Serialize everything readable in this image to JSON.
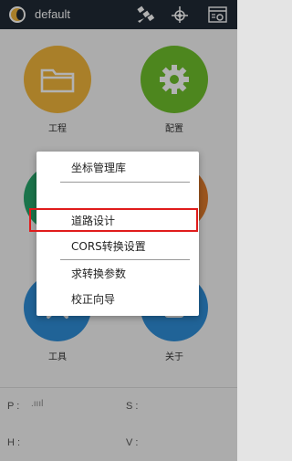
{
  "app": {
    "title": "default"
  },
  "toolbar": {
    "icons": [
      "satellite-icon",
      "crosshair-icon",
      "settings-panel-icon"
    ]
  },
  "grid": [
    {
      "label": "工程",
      "icon": "folder-icon",
      "color": "#f3b73b"
    },
    {
      "label": "配置",
      "icon": "gear-icon",
      "color": "#6fc12b"
    },
    {
      "label": "",
      "icon": "",
      "color": "#28a66c"
    },
    {
      "label": "",
      "icon": "",
      "color": "#e07a2c"
    },
    {
      "label": "工具",
      "icon": "tools-icon",
      "color": "#2f8fd8"
    },
    {
      "label": "关于",
      "icon": "info-icon",
      "color": "#2f8fd8"
    }
  ],
  "status": {
    "p": "P :",
    "p_signal": ".ıııl",
    "s": "S :",
    "h": "H :",
    "v": "V :"
  },
  "menu": {
    "items": [
      "坐标管理库",
      "道路设计",
      "CORS转换设置",
      "求转换参数",
      "校正向导"
    ],
    "highlighted": "道路设计"
  }
}
